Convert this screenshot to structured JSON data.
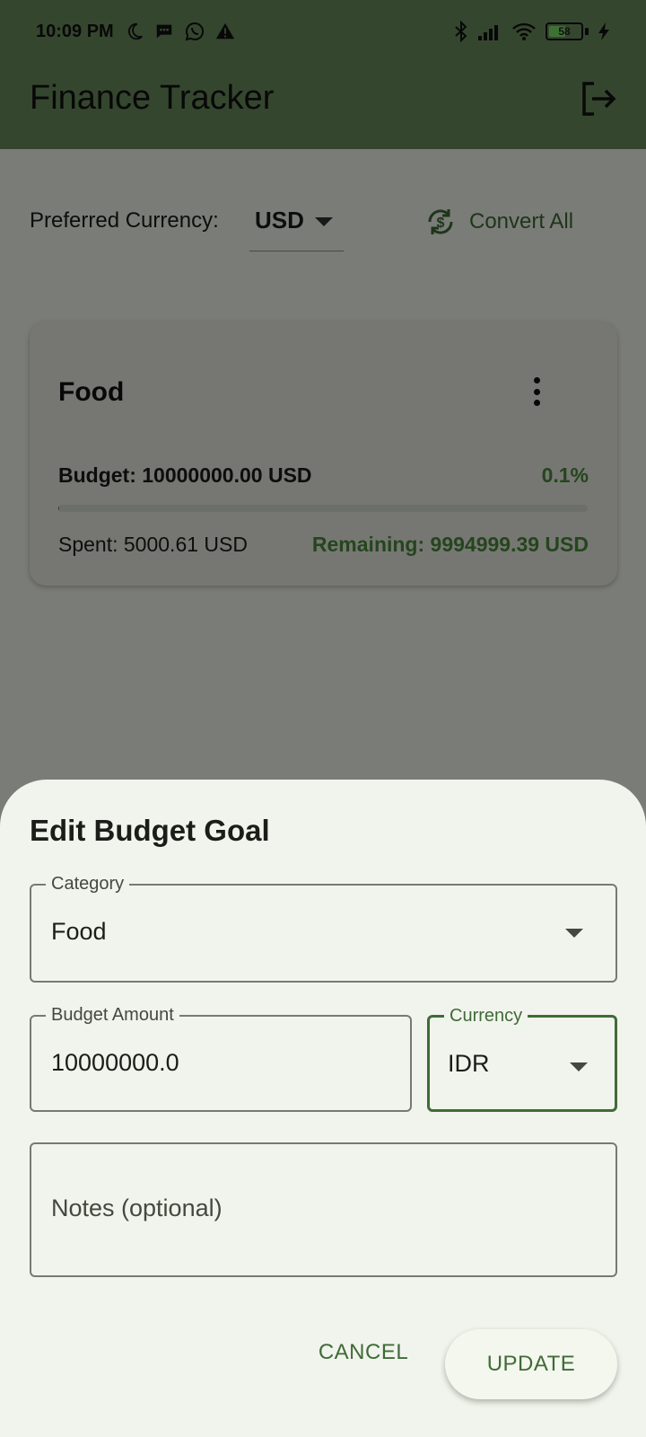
{
  "status_bar": {
    "time": "10:09 PM",
    "battery_level": "58",
    "icons_left": [
      "moon-icon",
      "message-icon",
      "whatsapp-icon",
      "warning-icon"
    ],
    "icons_right": [
      "bluetooth-icon",
      "signal-icon",
      "wifi-icon",
      "battery-icon",
      "charging-icon"
    ]
  },
  "app_bar": {
    "title": "Finance Tracker",
    "action_icon": "logout-icon"
  },
  "preferences": {
    "label": "Preferred Currency:",
    "currency": "USD",
    "convert_label": "Convert All"
  },
  "budget_card": {
    "category": "Food",
    "budget_text": "Budget: 10000000.00 USD",
    "percent_text": "0.1%",
    "progress_fraction": 0.001,
    "spent_text": "Spent: 5000.61 USD",
    "remaining_text": "Remaining: 9994999.39 USD"
  },
  "dialog": {
    "title": "Edit Budget Goal",
    "category_field": {
      "label": "Category",
      "value": "Food"
    },
    "amount_field": {
      "label": "Budget Amount",
      "value": "10000000.0"
    },
    "currency_field": {
      "label": "Currency",
      "value": "IDR"
    },
    "notes_field": {
      "placeholder": "Notes (optional)"
    },
    "cancel_label": "CANCEL",
    "update_label": "UPDATE"
  },
  "colors": {
    "app_bar": "#6a8c5f",
    "accent": "#3f6b37",
    "positive": "#4b8a3c",
    "sheet_background": "#f1f4ec"
  }
}
